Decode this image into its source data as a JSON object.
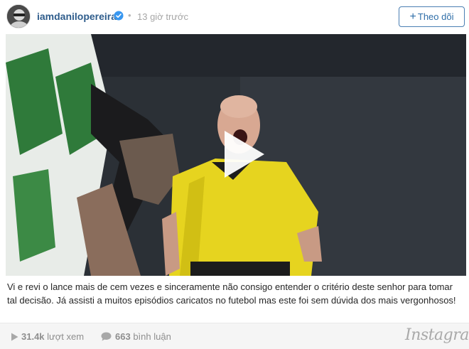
{
  "header": {
    "username": "iamdanilopereira",
    "separator": "•",
    "time_ago": "13 giờ trước",
    "follow_label": "Theo dõi",
    "follow_plus": "+"
  },
  "video": {
    "play_icon": "play-icon"
  },
  "post": {
    "caption": "Vi e revi o lance mais de cem vezes e sinceramente não consigo entender o critério deste senhor para tomar tal decisão. Já assisti a muitos episódios caricatos no futebol mas este foi sem dúvida dos mais vergonhosos!"
  },
  "footer": {
    "views_count": "31.4k",
    "views_unit": "lượt xem",
    "comments_count": "663",
    "comments_unit": "bình luận",
    "brand": "Instagram"
  },
  "colors": {
    "username": "#2f5d8c",
    "follow_accent": "#2f6ea8",
    "verified": "#3897f0",
    "muted": "#8e8e8e"
  }
}
